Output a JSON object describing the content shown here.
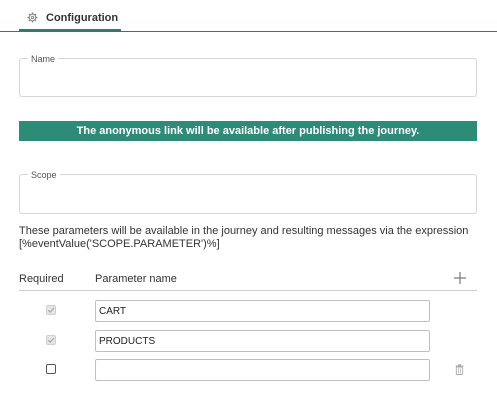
{
  "tabs": [
    {
      "label": "Configuration",
      "icon": "gear-icon"
    }
  ],
  "name_field": {
    "legend": "Name",
    "value": ""
  },
  "banner": {
    "text": "The anonymous link will be available after publishing the journey.",
    "color": "#2e8b77"
  },
  "scope_field": {
    "legend": "Scope",
    "value": ""
  },
  "help_text": "These parameters will be available in the journey and resulting messages via the expression [%eventValue('SCOPE.PARAMETER')%]",
  "parameters": {
    "columns": {
      "required": "Required",
      "name": "Parameter name"
    },
    "add_icon": "plus-icon",
    "rows": [
      {
        "required": true,
        "locked": true,
        "name": "CART"
      },
      {
        "required": true,
        "locked": true,
        "name": "PRODUCTS"
      },
      {
        "required": false,
        "locked": false,
        "name": "",
        "delete_icon": "trash-icon"
      }
    ]
  },
  "colors": {
    "accent": "#2e7d6f"
  }
}
